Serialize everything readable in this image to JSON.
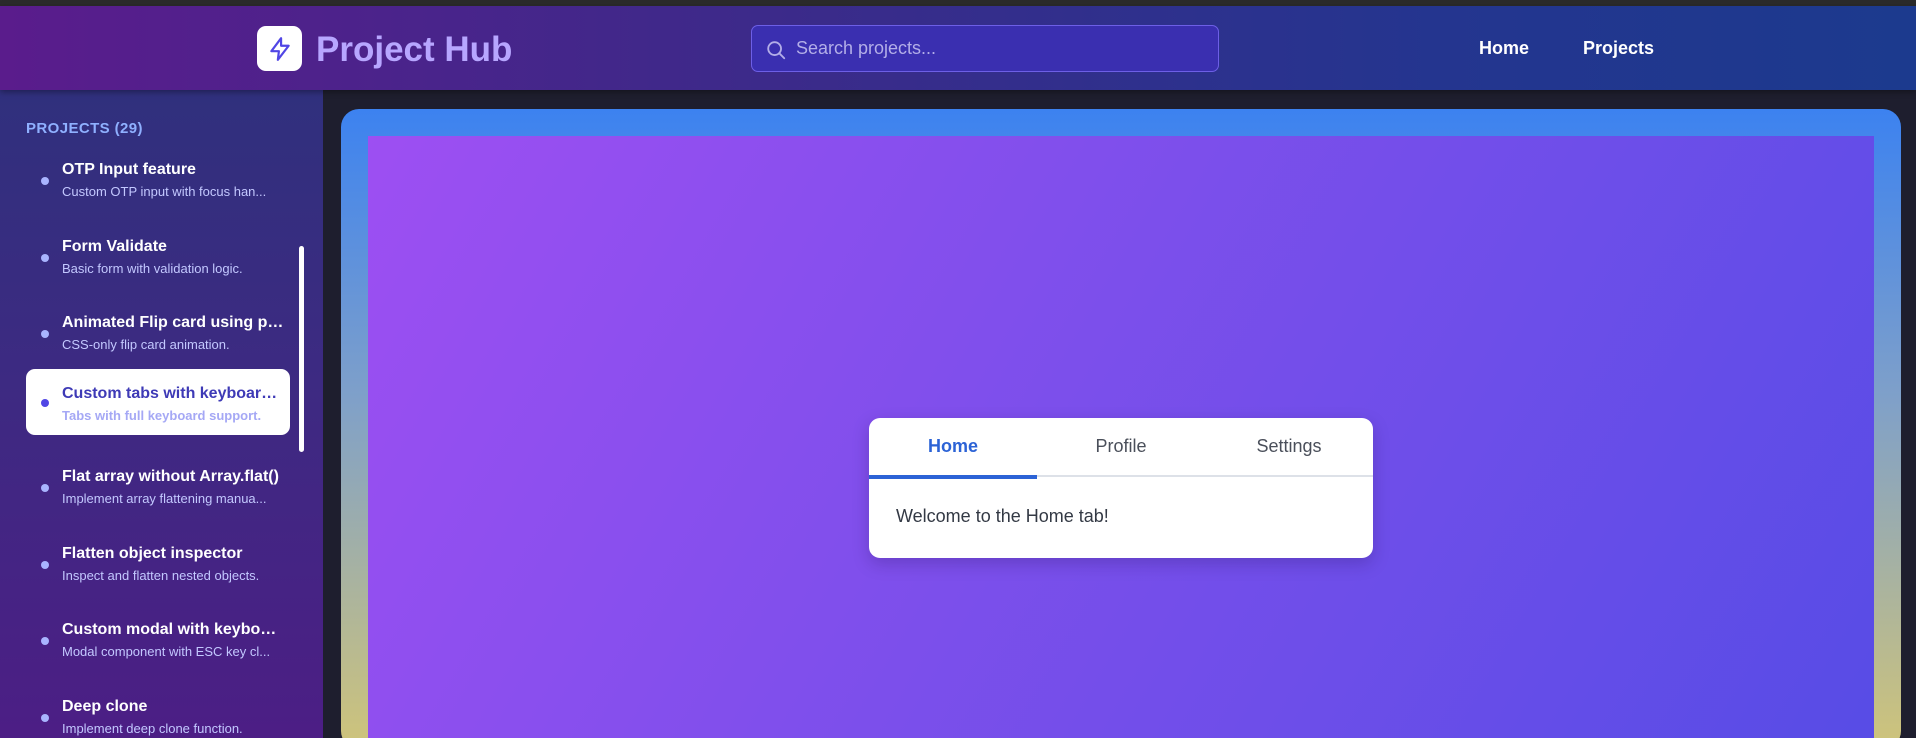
{
  "header": {
    "app_title": "Project Hub",
    "logo_icon": "lightning-bolt-icon",
    "search_placeholder": "Search projects...",
    "nav": [
      {
        "label": "Home"
      },
      {
        "label": "Projects"
      }
    ]
  },
  "sidebar": {
    "heading": "PROJECTS (29)",
    "items": [
      {
        "title": "OTP Input feature",
        "description": "Custom OTP input with focus han...",
        "active": false
      },
      {
        "title": "Form Validate",
        "description": "Basic form with validation logic.",
        "active": false
      },
      {
        "title": "Animated Flip card using pu...",
        "description": "CSS-only flip card animation.",
        "active": false
      },
      {
        "title": "Custom tabs with keyboard ...",
        "description": "Tabs with full keyboard support.",
        "active": true
      },
      {
        "title": "Flat array without Array.flat()",
        "description": "Implement array flattening manua...",
        "active": false
      },
      {
        "title": "Flatten object inspector",
        "description": "Inspect and flatten nested objects.",
        "active": false
      },
      {
        "title": "Custom modal with keyboar...",
        "description": "Modal component with ESC key cl...",
        "active": false
      },
      {
        "title": "Deep clone",
        "description": "Implement deep clone function.",
        "active": false
      }
    ]
  },
  "demo": {
    "tabs": [
      {
        "label": "Home",
        "active": true
      },
      {
        "label": "Profile",
        "active": false
      },
      {
        "label": "Settings",
        "active": false
      }
    ],
    "panel_text": "Welcome to the Home tab!"
  },
  "colors": {
    "accent_tab": "#2c63d6",
    "active_item_title": "#3e3ab6",
    "header_title": "#b7a6ff"
  }
}
